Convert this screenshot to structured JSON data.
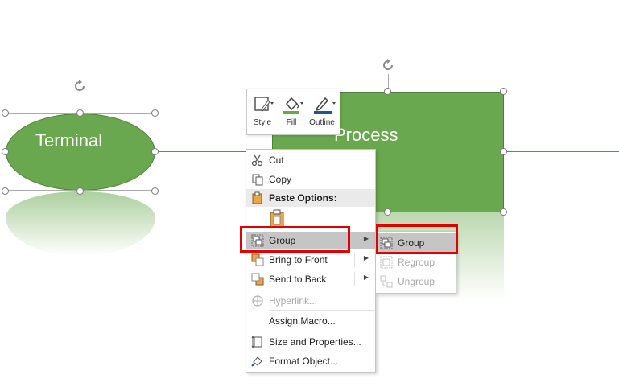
{
  "shapes": {
    "terminal": {
      "label": "Terminal"
    },
    "process": {
      "label": "Process"
    }
  },
  "mini_toolbar": {
    "style_label": "Style",
    "fill_label": "Fill",
    "outline_label": "Outline"
  },
  "context_menu": {
    "items": [
      {
        "label": "Cut",
        "icon": "scissors-icon"
      },
      {
        "label": "Copy",
        "icon": "copy-icon"
      },
      {
        "label": "Paste Options:",
        "icon": "paste-icon"
      },
      {
        "label": "Group",
        "icon": "group-icon"
      },
      {
        "label": "Bring to Front",
        "icon": "bring-to-front-icon"
      },
      {
        "label": "Send to Back",
        "icon": "send-to-back-icon"
      },
      {
        "label": "Hyperlink...",
        "icon": "hyperlink-icon"
      },
      {
        "label": "Assign Macro..."
      },
      {
        "label": "Size and Properties...",
        "icon": "size-properties-icon"
      },
      {
        "label": "Format Object...",
        "icon": "format-object-icon"
      }
    ]
  },
  "submenu": {
    "items": [
      {
        "label": "Group",
        "icon": "group-icon"
      },
      {
        "label": "Regroup",
        "icon": "regroup-icon"
      },
      {
        "label": "Ungroup",
        "icon": "ungroup-icon"
      }
    ]
  },
  "colors": {
    "shape_fill": "#6aa84f",
    "highlight": "#c5c5c5",
    "callout": "#e00000"
  }
}
